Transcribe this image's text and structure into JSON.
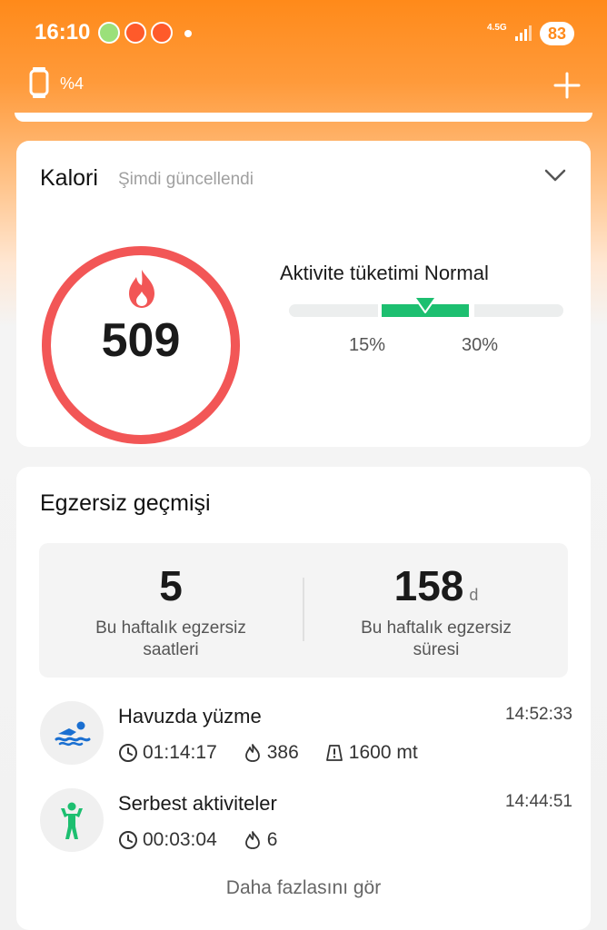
{
  "status_bar": {
    "time": "16:10",
    "network": "4.5G",
    "battery": "83"
  },
  "device": {
    "battery_pct": "%4"
  },
  "calorie_card": {
    "title": "Kalori",
    "subtitle": "Şimdi güncellendi",
    "value": "509",
    "activity_label": "Aktivite tüketimi Normal",
    "range_low": "15%",
    "range_high": "30%"
  },
  "exercise_card": {
    "title": "Egzersiz geçmişi",
    "summary": [
      {
        "value": "5",
        "unit": "",
        "label_line1": "Bu haftalık egzersiz",
        "label_line2": "saatleri"
      },
      {
        "value": "158",
        "unit": "d",
        "label_line1": "Bu haftalık egzersiz",
        "label_line2": "süresi"
      }
    ],
    "activities": [
      {
        "name": "Havuzda yüzme",
        "time": "14:52:33",
        "duration": "01:14:17",
        "calories": "386",
        "distance": "1600 mt",
        "icon": "swimming-icon",
        "color": "#1a6fd1"
      },
      {
        "name": "Serbest aktiviteler",
        "time": "14:44:51",
        "duration": "00:03:04",
        "calories": "6",
        "icon": "free-activity-icon",
        "color": "#1dbf70"
      }
    ],
    "more_label": "Daha fazlasını gör"
  },
  "colors": {
    "accent": "#ff8a1a",
    "ring": "#f25656",
    "normal_range": "#1dbf70"
  }
}
